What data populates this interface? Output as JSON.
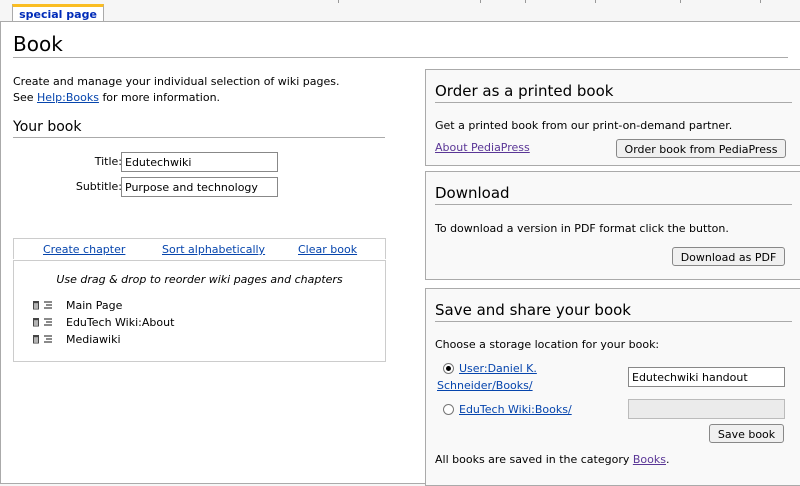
{
  "tabs": {
    "special_page": "special page"
  },
  "page": {
    "title": "Book",
    "intro_line1": "Create and manage your individual selection of wiki pages.",
    "intro_see": "See",
    "intro_link": "Help:Books",
    "intro_after": "for more information."
  },
  "your_book": {
    "heading": "Your book",
    "title_label": "Title:",
    "title_value": "Edutechwiki",
    "subtitle_label": "Subtitle:",
    "subtitle_value": "Purpose and technology"
  },
  "chapter_bar": {
    "create_chapter": "Create chapter",
    "sort_alphabetically": "Sort alphabetically",
    "clear_book": "Clear book"
  },
  "items_box": {
    "hint": "Use drag & drop to reorder wiki pages and chapters",
    "items": [
      {
        "label": "Main Page",
        "icon_remove": "trash-icon",
        "icon_move": "drag-handle-icon"
      },
      {
        "label": "EduTech Wiki:About",
        "icon_remove": "trash-icon",
        "icon_move": "drag-handle-icon"
      },
      {
        "label": "Mediawiki",
        "icon_remove": "trash-icon",
        "icon_move": "drag-handle-icon"
      }
    ]
  },
  "order": {
    "heading": "Order as a printed book",
    "text": "Get a printed book from our print-on-demand partner.",
    "about_link": "About PediaPress",
    "button": "Order book from PediaPress"
  },
  "download": {
    "heading": "Download",
    "text": "To download a version in PDF format click the button.",
    "button": "Download as PDF"
  },
  "save": {
    "heading": "Save and share your book",
    "text": "Choose a storage location for your book:",
    "user_option_line1": "User:Daniel K.",
    "user_option_line2": "Schneider/Books/",
    "user_option_selected": true,
    "user_name_value": "Edutechwiki handout",
    "community_option": "EduTech Wiki:Books/",
    "community_option_selected": false,
    "community_name_value": "",
    "button": "Save book",
    "footer_before": "All books are saved in the category",
    "footer_link": "Books",
    "footer_after": "."
  },
  "colors": {
    "link": "#0645ad",
    "visited_link": "#5a3696",
    "tab_accent": "#fabd23",
    "border": "#aaaaaa",
    "panel_bg": "#f9f9f9"
  }
}
